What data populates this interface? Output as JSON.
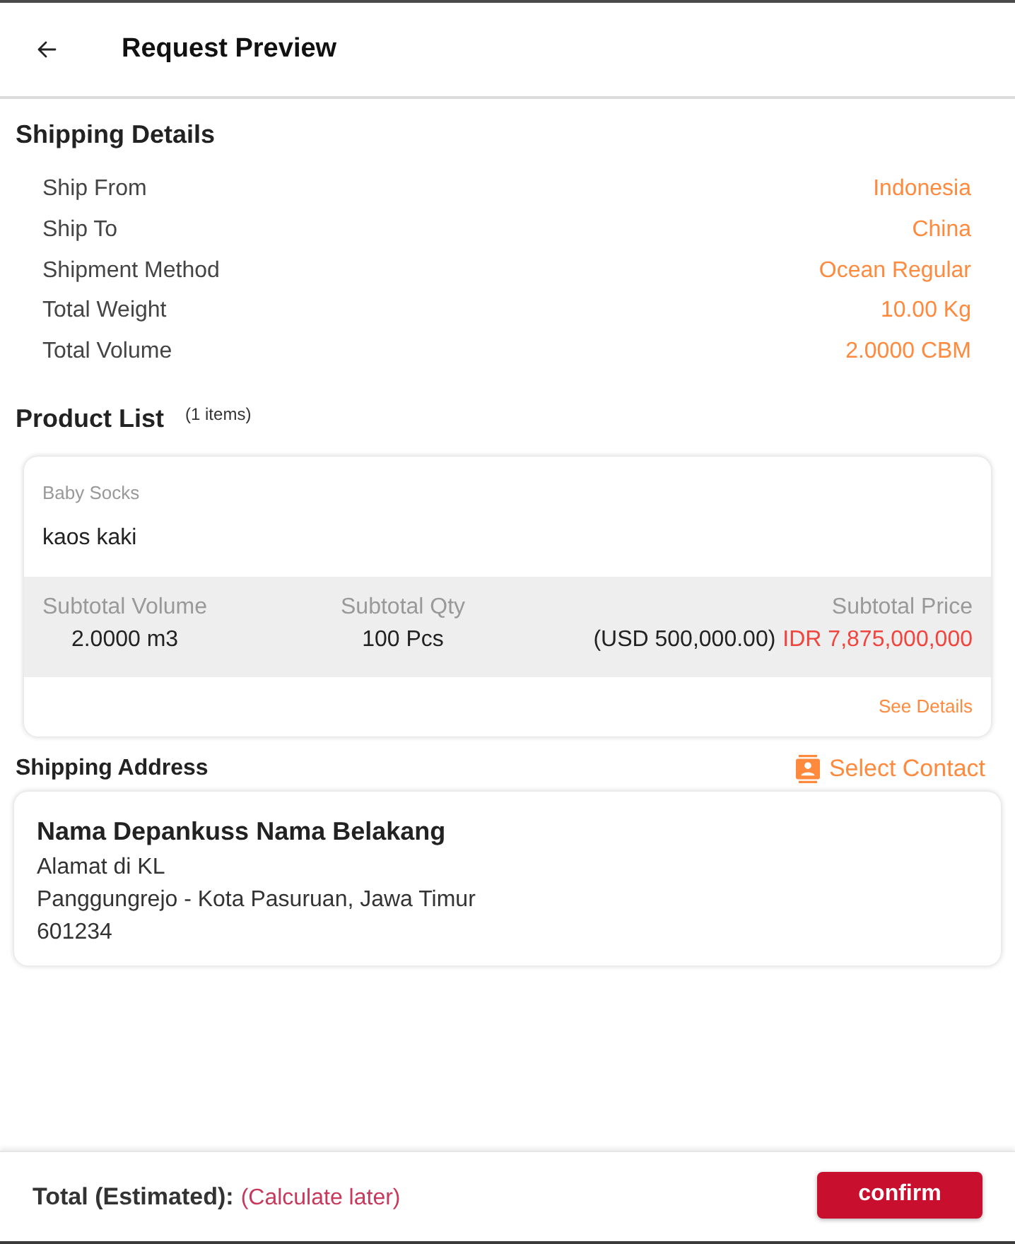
{
  "header": {
    "title": "Request Preview"
  },
  "shipping_details": {
    "title": "Shipping Details",
    "rows": [
      {
        "label": "Ship From",
        "value": "Indonesia"
      },
      {
        "label": "Ship To",
        "value": "China"
      },
      {
        "label": "Shipment Method",
        "value": "Ocean Regular"
      },
      {
        "label": "Total Weight",
        "value": "10.00 Kg"
      },
      {
        "label": "Total Volume",
        "value": "2.0000 CBM"
      }
    ]
  },
  "product_list": {
    "title": "Product List",
    "count": "(1 items)",
    "products": [
      {
        "category": "Baby Socks",
        "name": "kaos kaki",
        "subtotal_volume": {
          "label": "Subtotal Volume",
          "value": "2.0000 m3"
        },
        "subtotal_qty": {
          "label": "Subtotal Qty",
          "value": "100 Pcs"
        },
        "subtotal_price": {
          "label": "Subtotal Price",
          "value_usd": "(USD 500,000.00)",
          "value_idr": "IDR 7,875,000,000"
        },
        "details_link": "See Details"
      }
    ]
  },
  "shipping_address": {
    "title": "Shipping Address",
    "select_contact": "Select Contact",
    "name": "Nama Depankuss Nama Belakang",
    "lines": [
      "Alamat di KL",
      "Panggungrejo - Kota Pasuruan, Jawa Timur",
      "601234"
    ]
  },
  "footer": {
    "total_label": "Total (Estimated):",
    "total_value": "(Calculate later)",
    "confirm": "confirm"
  }
}
